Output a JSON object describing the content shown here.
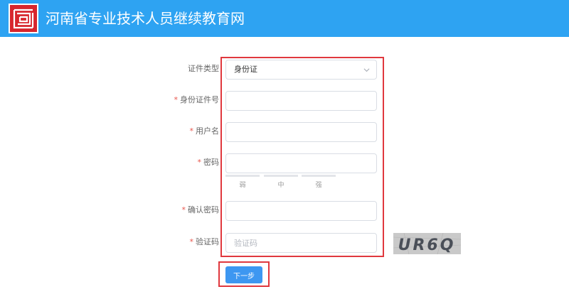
{
  "header": {
    "title": "河南省专业技术人员继续教育网",
    "background": "#2ea3f2",
    "logo_icon": "red-square-seal-logo"
  },
  "form": {
    "id_type": {
      "label": "证件类型",
      "selected": "身份证"
    },
    "id_number": {
      "required_mark": "*",
      "label": "身份证件号",
      "value": ""
    },
    "username": {
      "required_mark": "*",
      "label": "用户名",
      "value": ""
    },
    "password": {
      "required_mark": "*",
      "label": "密码",
      "value": "",
      "strength_levels": [
        "弱",
        "中",
        "强"
      ]
    },
    "confirm_password": {
      "required_mark": "*",
      "label": "确认密码",
      "value": ""
    },
    "captcha": {
      "required_mark": "*",
      "label": "验证码",
      "placeholder": "验证码",
      "image_text": "UR6Q"
    }
  },
  "actions": {
    "next_label": "下一步",
    "button_color": "#3d97f1"
  },
  "highlight_color": "#e0383e"
}
